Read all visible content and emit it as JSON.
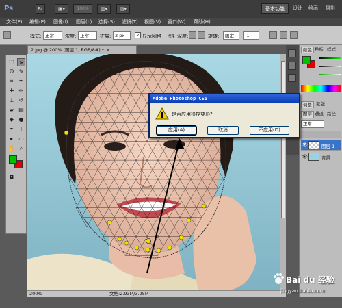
{
  "app": {
    "logo": "Ps",
    "zoom_display": "100%",
    "workspaces": [
      "基本功能",
      "设计",
      "绘画",
      "摄影"
    ],
    "icons": [
      "bridge-icon",
      "mini-bridge-icon",
      "arrange-documents-icon",
      "screen-mode-icon"
    ]
  },
  "menu": [
    "文件(F)",
    "编辑(E)",
    "图像(I)",
    "图层(L)",
    "选择(S)",
    "滤镜(T)",
    "视图(V)",
    "窗口(W)",
    "帮助(H)"
  ],
  "options": {
    "mode_label": "模式:",
    "mode_value": "正常",
    "density_label": "浓度:",
    "density_value": "正常",
    "expand_label": "扩展:",
    "expand_value": "2 px",
    "show_mesh_label": "显示网格",
    "show_mesh_checked": true,
    "pin_depth_label": "图钉深度:",
    "rotate_label": "旋转:",
    "rotate_value": "固定",
    "angle_value": "-1"
  },
  "document": {
    "tab_title": "2.jpg @ 200% (图层 1, RGB/8#) *",
    "close": "×"
  },
  "status": {
    "zoom": "200%",
    "doc_size": "文档:2.93M/3.95M"
  },
  "colors": {
    "foreground": "#00c000",
    "background": "#e00000",
    "dialog_title_start": "#2d62d8",
    "layer_selected": "#3a74c7"
  },
  "panels": {
    "color_tabs": [
      "颜色",
      "色板",
      "样式"
    ],
    "adjust_tabs": [
      "调整",
      "蒙版"
    ],
    "layers_tabs": [
      "图层",
      "通道",
      "路径"
    ],
    "blend_mode": "正常",
    "layers": [
      {
        "name": "图层 1",
        "selected": true
      },
      {
        "name": "背景",
        "selected": false
      }
    ]
  },
  "dialog": {
    "title": "Adobe Photoshop CS5",
    "message": "是否应用操控变形?",
    "buttons": [
      "应用(A)",
      "取消",
      "不应用(D)"
    ]
  },
  "watermark": {
    "brand": "Bai du 经验",
    "url": "jingyan.baidu.com"
  }
}
